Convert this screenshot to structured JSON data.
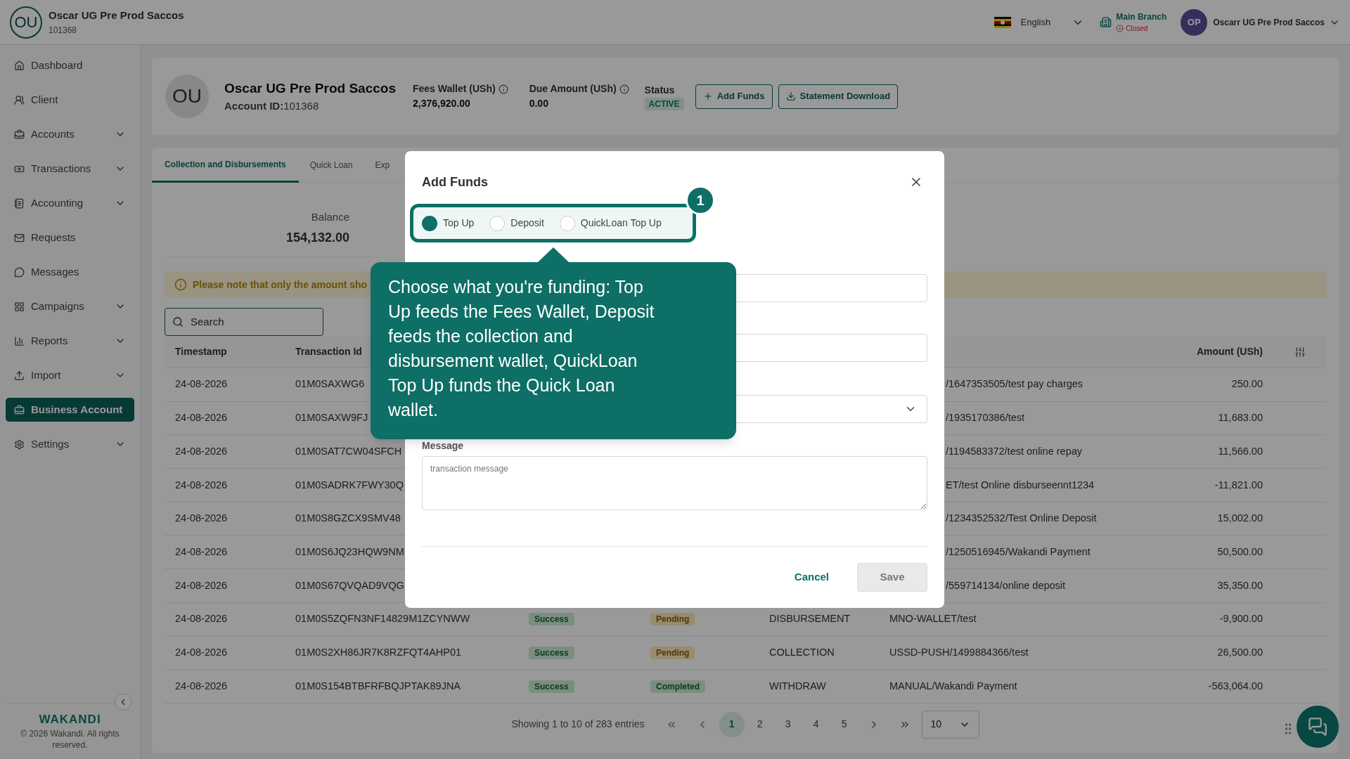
{
  "header": {
    "logo": "OU",
    "org_name": "Oscar UG Pre Prod Saccos",
    "org_id": "101368",
    "language": "English",
    "branch": {
      "name": "Main Branch",
      "status": "Closed"
    },
    "user": {
      "initials": "OP",
      "name": "Oscarr UG Pre Prod Saccos"
    }
  },
  "sidebar": {
    "items": [
      {
        "label": "Dashboard",
        "expandable": false,
        "selected": false
      },
      {
        "label": "Client",
        "expandable": false,
        "selected": false
      },
      {
        "label": "Accounts",
        "expandable": true,
        "selected": false
      },
      {
        "label": "Transactions",
        "expandable": true,
        "selected": false
      },
      {
        "label": "Accounting",
        "expandable": true,
        "selected": false
      },
      {
        "label": "Requests",
        "expandable": false,
        "selected": false
      },
      {
        "label": "Messages",
        "expandable": false,
        "selected": false
      },
      {
        "label": "Campaigns",
        "expandable": true,
        "selected": false
      },
      {
        "label": "Reports",
        "expandable": true,
        "selected": false
      },
      {
        "label": "Import",
        "expandable": true,
        "selected": false
      },
      {
        "label": "Business Account",
        "expandable": false,
        "selected": true
      },
      {
        "label": "Settings",
        "expandable": true,
        "selected": false
      }
    ],
    "brand": "WAKANDI",
    "copyright": "© 2026 Wakandi. All rights reserved."
  },
  "account": {
    "avatar": "OU",
    "name": "Oscar UG Pre Prod Saccos",
    "id_label": "Account ID:",
    "id": "101368",
    "fees_wallet": {
      "label": "Fees Wallet (USh)",
      "value": "2,376,920.00"
    },
    "due_amount": {
      "label": "Due Amount (USh)",
      "value": "0.00"
    },
    "status": {
      "label": "Status",
      "value": "ACTIVE"
    },
    "buttons": [
      "Add Funds",
      "Statement Download"
    ]
  },
  "tabs": [
    {
      "label": "Collection and Disbursements",
      "selected": true
    },
    {
      "label": "Quick Loan",
      "selected": false
    },
    {
      "label": "Exp",
      "selected": false
    }
  ],
  "balance": {
    "label": "Balance",
    "value": "154,132.00"
  },
  "notice": "Please note that only the amount sho",
  "search": {
    "placeholder": "Search"
  },
  "table": {
    "columns": [
      "Timestamp",
      "Transaction Id",
      "Amount (USh)"
    ],
    "rows": [
      {
        "timestamp": "24-08-2026",
        "transaction_id": "01M0SAXWG6",
        "description": "/1647353505/test pay charges",
        "amount": "250.00"
      },
      {
        "timestamp": "24-08-2026",
        "transaction_id": "01M0SAXW9FJ",
        "description": "/1935170386/test",
        "amount": "11,683.00"
      },
      {
        "timestamp": "24-08-2026",
        "transaction_id": "01M0SAT7CW04SFCH",
        "description": "/1194583372/test online repay",
        "amount": "11,566.00"
      },
      {
        "timestamp": "24-08-2026",
        "transaction_id": "01M0SADRK7FWY30Q",
        "description": "ET/test Online disburseennt1234",
        "amount": "-11,821.00"
      },
      {
        "timestamp": "24-08-2026",
        "transaction_id": "01M0S8GZCX9SMV48",
        "description": "/1234352532/Test Online Deposit",
        "amount": "15,002.00"
      },
      {
        "timestamp": "24-08-2026",
        "transaction_id": "01M0S6JQ23HQW9NM",
        "description": "/1250516945/Wakandi Payment",
        "amount": "50,500.00"
      },
      {
        "timestamp": "24-08-2026",
        "transaction_id": "01M0S67QVQAD9VQG",
        "description": "/559714134/online deposit",
        "amount": "35,350.00"
      },
      {
        "timestamp": "24-08-2026",
        "transaction_id": "01M0S5ZQFN3NF14829M1ZCYNWW",
        "status": "Success",
        "approval": {
          "label": "Pending",
          "kind": "pending"
        },
        "type": "DISBURSEMENT",
        "description": "MNO-WALLET/test",
        "amount": "-9,900.00"
      },
      {
        "timestamp": "24-08-2026",
        "transaction_id": "01M0S2XH86JR7K8RZFQT4AHP01",
        "status": "Success",
        "approval": {
          "label": "Pending",
          "kind": "pending"
        },
        "type": "COLLECTION",
        "description": "USSD-PUSH/1499884366/test",
        "amount": "26,500.00"
      },
      {
        "timestamp": "24-08-2026",
        "transaction_id": "01M0S154BTBFRFBQJPTAK89JNA",
        "status": "Success",
        "approval": {
          "label": "Completed",
          "kind": "completed"
        },
        "type": "WITHDRAW",
        "description": "MANUAL/Wakandi Payment",
        "amount": "-563,064.00"
      }
    ]
  },
  "pagination": {
    "summary": "Showing 1 to 10 of 283 entries",
    "pages": [
      {
        "label": "1",
        "selected": true
      },
      {
        "label": "2",
        "selected": false
      },
      {
        "label": "3",
        "selected": false
      },
      {
        "label": "4",
        "selected": false
      },
      {
        "label": "5",
        "selected": false
      }
    ],
    "per_page": "10"
  },
  "modal": {
    "title": "Add Funds",
    "options": [
      {
        "label": "Top Up",
        "selected": true
      },
      {
        "label": "Deposit",
        "selected": false
      },
      {
        "label": "QuickLoan Top Up",
        "selected": false
      }
    ],
    "step": "1",
    "tooltip": "Choose what you're funding: Top Up feeds the Fees Wallet, Deposit feeds the collection and disbursement wallet, QuickLoan Top Up funds the Quick Loan wallet.",
    "message": {
      "label": "Message",
      "placeholder": "transaction message"
    },
    "cancel": "Cancel",
    "save": "Save",
    "save_disabled": true
  }
}
